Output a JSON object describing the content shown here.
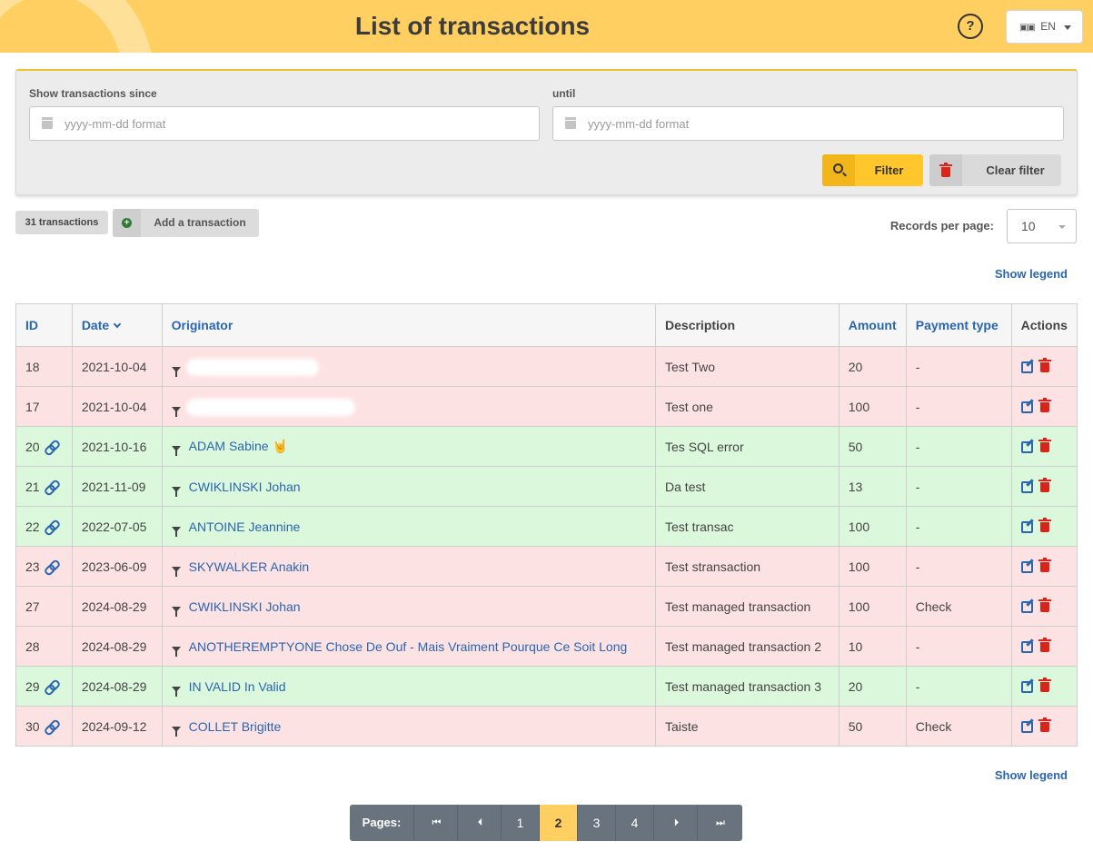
{
  "header": {
    "title": "List of transactions",
    "help_label": "?",
    "language": "EN",
    "colors": {
      "header_bg": "#ffd061",
      "accent": "#ffc72c"
    }
  },
  "filter": {
    "since_label": "Show transactions since",
    "since_placeholder": "yyyy-mm-dd format",
    "until_label": "until",
    "until_placeholder": "yyyy-mm-dd format",
    "filter_button": "Filter",
    "clear_button": "Clear filter"
  },
  "toolbar": {
    "count_badge": "31 transactions",
    "add_button": "Add a transaction",
    "records_label": "Records per page:",
    "records_value": "10",
    "show_legend": "Show legend"
  },
  "table": {
    "headers": {
      "id": "ID",
      "date": "Date",
      "originator": "Originator",
      "description": "Description",
      "amount": "Amount",
      "payment_type": "Payment type",
      "actions": "Actions"
    },
    "rows": [
      {
        "id": "18",
        "linked": false,
        "status": "red",
        "date": "2021-10-04",
        "originator": "",
        "redacted": true,
        "description": "Test Two",
        "amount": "20",
        "payment_type": "-"
      },
      {
        "id": "17",
        "linked": false,
        "status": "red",
        "date": "2021-10-04",
        "originator": "",
        "redacted": true,
        "description": "Test one",
        "amount": "100",
        "payment_type": "-"
      },
      {
        "id": "20",
        "linked": true,
        "status": "green",
        "date": "2021-10-16",
        "originator": "ADAM Sabine 🤘",
        "redacted": false,
        "description": "Tes SQL error",
        "amount": "50",
        "payment_type": "-"
      },
      {
        "id": "21",
        "linked": true,
        "status": "green",
        "date": "2021-11-09",
        "originator": "CWIKLINSKI Johan",
        "redacted": false,
        "description": "Da test",
        "amount": "13",
        "payment_type": "-"
      },
      {
        "id": "22",
        "linked": true,
        "status": "green",
        "date": "2022-07-05",
        "originator": "ANTOINE Jeannine",
        "redacted": false,
        "description": "Test transac",
        "amount": "100",
        "payment_type": "-"
      },
      {
        "id": "23",
        "linked": true,
        "status": "red",
        "date": "2023-06-09",
        "originator": "SKYWALKER Anakin",
        "redacted": false,
        "description": "Test stransaction",
        "amount": "100",
        "payment_type": "-"
      },
      {
        "id": "27",
        "linked": false,
        "status": "red",
        "date": "2024-08-29",
        "originator": "CWIKLINSKI Johan",
        "redacted": false,
        "description": "Test managed transaction",
        "amount": "100",
        "payment_type": "Check"
      },
      {
        "id": "28",
        "linked": false,
        "status": "red",
        "date": "2024-08-29",
        "originator": "ANOTHEREMPTYONE Chose De Ouf - Mais Vraiment Pourque Ce Soit Long",
        "redacted": false,
        "description": "Test managed transaction 2",
        "amount": "10",
        "payment_type": "-"
      },
      {
        "id": "29",
        "linked": true,
        "status": "green",
        "date": "2024-08-29",
        "originator": "IN VALID In Valid",
        "redacted": false,
        "description": "Test managed transaction 3",
        "amount": "20",
        "payment_type": "-"
      },
      {
        "id": "30",
        "linked": true,
        "status": "red",
        "date": "2024-09-12",
        "originator": "COLLET Brigitte",
        "redacted": false,
        "description": "Taiste",
        "amount": "50",
        "payment_type": "Check"
      }
    ]
  },
  "pagination": {
    "label": "Pages:",
    "first": "⏮",
    "prev": "⏴",
    "pages": [
      "1",
      "2",
      "3",
      "4"
    ],
    "current": "2",
    "next": "⏵",
    "last": "⏭"
  }
}
